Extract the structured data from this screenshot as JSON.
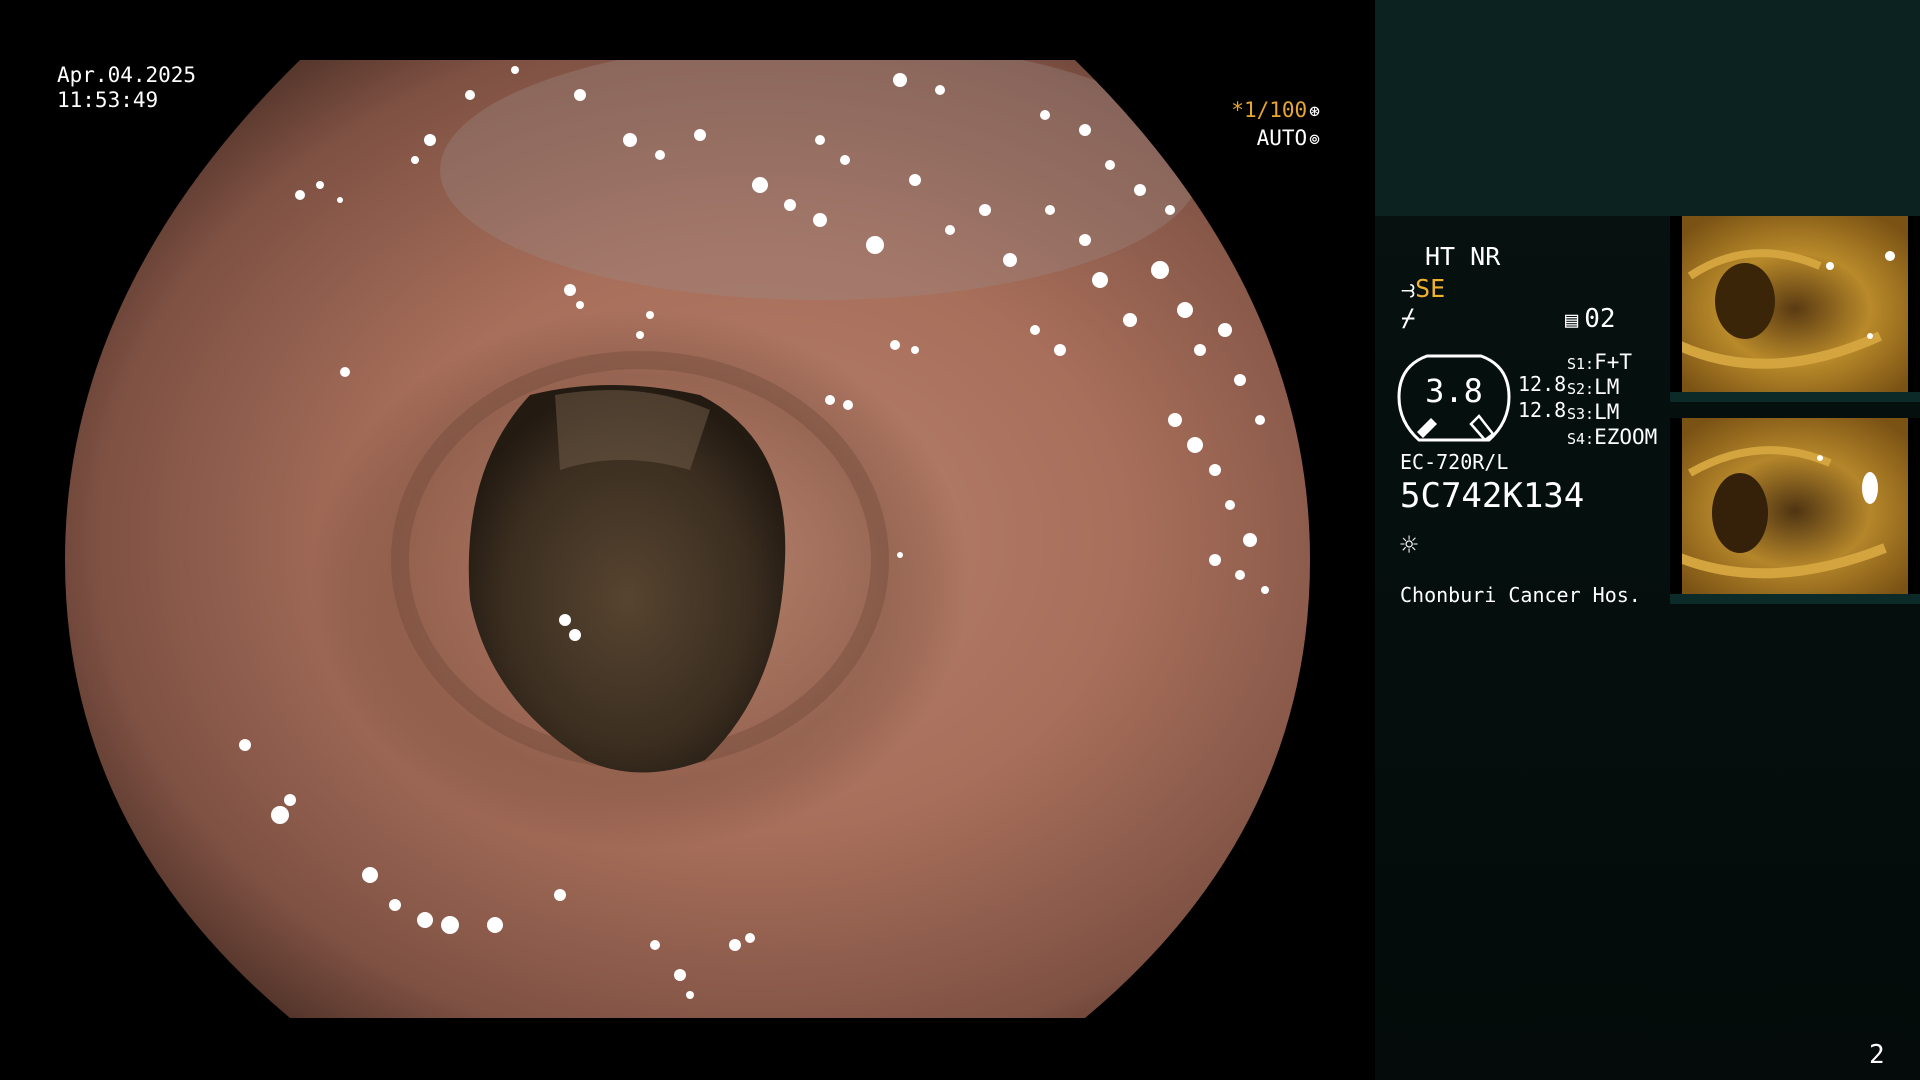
{
  "overlay": {
    "date": "Apr.04.2025",
    "time": "11:53:49",
    "shutter": "*1/100",
    "shutter_icon": "aperture-icon",
    "iris_mode": "AUTO",
    "iris_icon": "iris-icon"
  },
  "panel": {
    "ht_nr": "HT NR",
    "enhance_prefix": "⥽",
    "enhance": "SE",
    "tilde": "⌿",
    "memory_icon": "memory-card-icon",
    "memory_count": "02",
    "gauge_value": "3.8",
    "gauge_top": "12.8",
    "gauge_bottom": "12.8",
    "switches": [
      {
        "key": "S1:",
        "value": "F+T"
      },
      {
        "key": "S2:",
        "value": "LM"
      },
      {
        "key": "S3:",
        "value": "LM"
      },
      {
        "key": "S4:",
        "value": "EZOOM"
      }
    ],
    "scope_model": "EC-720R/L",
    "scope_serial": "5C742K134",
    "light_icon": "sun-icon",
    "hospital": "Chonburi Cancer Hos.",
    "page_number": "2"
  },
  "colors": {
    "accent_orange": "#e8a531",
    "panel_header": "#0c2220",
    "panel_bg": "#061311"
  }
}
